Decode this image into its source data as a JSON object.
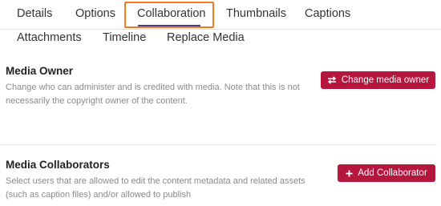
{
  "tabs": {
    "row1": [
      "Details",
      "Options",
      "Collaboration",
      "Thumbnails",
      "Captions"
    ],
    "row2": [
      "Attachments",
      "Timeline",
      "Replace Media"
    ],
    "active": "Collaboration"
  },
  "media_owner": {
    "title": "Media Owner",
    "description": "Change who can administer and is credited with media. Note that this is not necessarily the copyright owner of the content.",
    "button_label": "Change media owner",
    "button_icon": "swap-arrows-icon"
  },
  "media_collaborators": {
    "title": "Media Collaborators",
    "description": "Select users that are allowed to edit the content metadata and related assets (such as caption files) and/or allowed to publish",
    "button_label": "Add Collaborator",
    "button_icon": "plus-icon"
  },
  "colors": {
    "button_bg": "#b5163e",
    "active_tab_highlight": "#f47b20",
    "active_tab_underline": "#4a3f8c"
  }
}
